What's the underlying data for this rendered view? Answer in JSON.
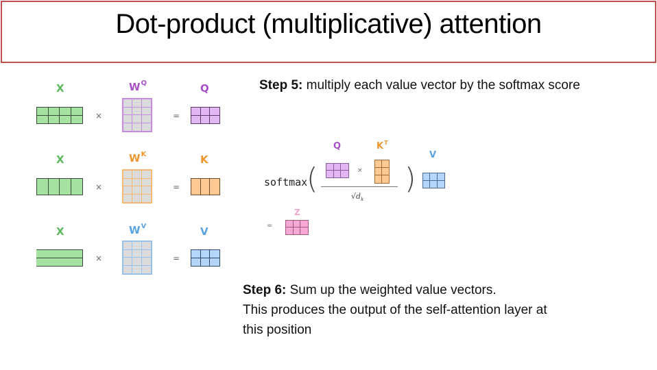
{
  "title": "Dot-product (multiplicative) attention",
  "colors": {
    "title_border": "#c0504d",
    "x_label": "#5cb85c",
    "x_fill": "#a6e3a1",
    "q_label": "#a94fc8",
    "q_fill": "#e3b8f2",
    "k_label": "#f0962e",
    "k_fill": "#ffc994",
    "v_label": "#5ba3e0",
    "v_fill": "#b5d6fb",
    "z_label": "#f0a6cc",
    "z_fill": "#f7a8d4",
    "weight_fill": "#dcdcdc"
  },
  "left_panel": {
    "rows": [
      {
        "input": "X",
        "weight": "W",
        "weight_sup": "Q",
        "output": "Q",
        "times": "×",
        "equals": "="
      },
      {
        "input": "X",
        "weight": "W",
        "weight_sup": "K",
        "output": "K",
        "times": "×",
        "equals": "="
      },
      {
        "input": "X",
        "weight": "W",
        "weight_sup": "V",
        "output": "V",
        "times": "×",
        "equals": "="
      }
    ]
  },
  "step5": {
    "bold": "Step 5:",
    "text": " multiply each value vector by the softmax score"
  },
  "formula": {
    "softmax": "softmax",
    "open_paren": "(",
    "close_paren": ")",
    "q_label": "Q",
    "k_label": "K",
    "k_sup": "T",
    "v_label": "V",
    "times": "×",
    "denominator": "√d",
    "denominator_sub": "k",
    "equals": "=",
    "z_label": "Z"
  },
  "step6": {
    "bold": "Step 6:",
    "line1": " Sum up the weighted value vectors.",
    "line2": "This produces the output of the self-attention layer at",
    "line3": "this position"
  }
}
